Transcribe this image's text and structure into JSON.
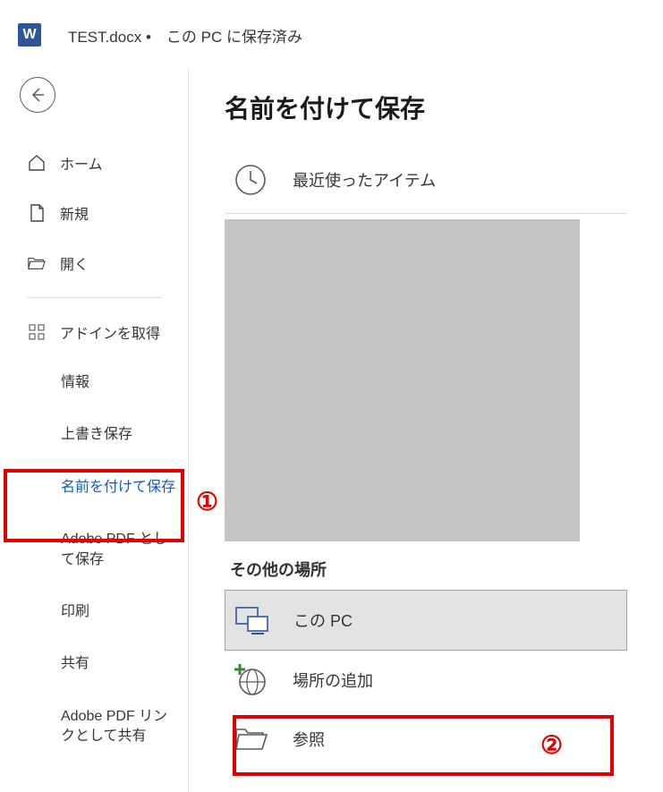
{
  "titlebar": {
    "filename": "TEST.docx",
    "status": "•　この PC に保存済み"
  },
  "sidebar": {
    "home": "ホーム",
    "new": "新規",
    "open": "開く",
    "addins": "アドインを取得",
    "info": "情報",
    "save": "上書き保存",
    "saveas": "名前を付けて保存",
    "pdf": "Adobe PDF として保存",
    "print": "印刷",
    "share": "共有",
    "pdflink": "Adobe PDF リンクとして共有"
  },
  "content": {
    "title": "名前を付けて保存",
    "recent": "最近使ったアイテム",
    "other_section": "その他の場所",
    "this_pc": "この PC",
    "add_location": "場所の追加",
    "browse": "参照"
  },
  "annotations": {
    "one": "①",
    "two": "②"
  }
}
